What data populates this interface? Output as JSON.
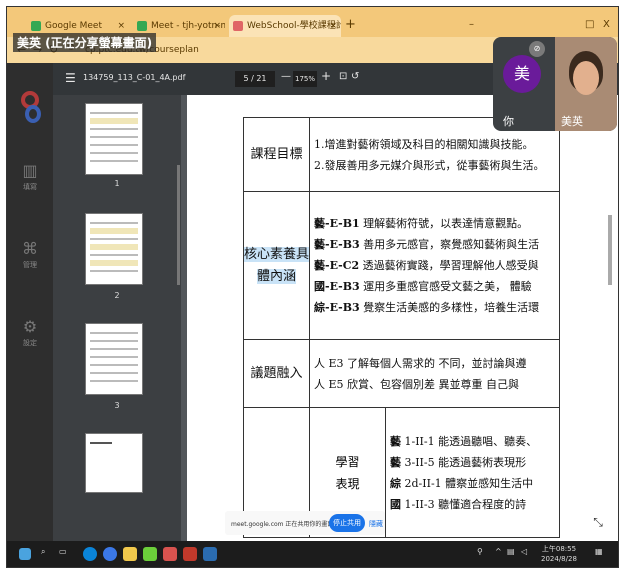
{
  "share_banner": "美英 (正在分享螢幕畫面)",
  "browser": {
    "tabs": [
      {
        "label": "Google Meet",
        "active": false
      },
      {
        "label": "Meet - tjh-yotn-mb",
        "active": false
      },
      {
        "label": "WebSchool-學校課程計畫填報",
        "active": true
      }
    ],
    "new_tab": "+",
    "window_controls": {
      "minimize": "–",
      "maximize": "□",
      "close": "X"
    },
    "url": "cp.ptc.edu.tw/courseplan"
  },
  "left_rail": {
    "items": [
      {
        "label": "填寫",
        "icon": "chart-icon"
      },
      {
        "label": "管理",
        "icon": "grid-icon"
      },
      {
        "label": "設定",
        "icon": "gear-icon"
      }
    ]
  },
  "pdf_toolbar": {
    "title": "134759_113_C-01_4A.pdf",
    "page_indicator": "5 / 21",
    "zoom": "175%",
    "zoom_minus": "—",
    "zoom_plus": "+"
  },
  "thumbnails": {
    "page_numbers": [
      "1",
      "2",
      "3"
    ]
  },
  "document": {
    "rows": [
      {
        "label": "課程目標",
        "lines": [
          "1.增進對藝術領域及科目的相關知識與技能。",
          "2.發展善用多元媒介與形式，從事藝術與生活。"
        ]
      },
      {
        "label": "核心素養具體內涵",
        "lines": [
          {
            "code": "藝-E-B1",
            "text": " 理解藝術符號，以表達情意觀點。"
          },
          {
            "code": "藝-E-B3",
            "text": " 善用多元感官，察覺感知藝術與生活"
          },
          {
            "code": "藝-E-C2",
            "text": " 透過藝術實踐，學習理解他人感受與"
          },
          {
            "code": "國-E-B3",
            "text": " 運用多重感官感受文藝之美， 體驗"
          },
          {
            "code": "綜-E-B3",
            "text": " 覺察生活美感的多樣性，培養生活環"
          }
        ]
      },
      {
        "label": "議題融入",
        "lines": [
          "人 E3 了解每個人需求的 不同，並討論與遵",
          "人 E5 欣賞、包容個別差 異並尊重 自己與"
        ]
      },
      {
        "sub_label_1": "學習",
        "sub_label_2": "表現",
        "lines": [
          {
            "code": "藝",
            "text": " 1-II-1 能透過聽唱、聽奏、"
          },
          {
            "code": "藝",
            "text": " 3-II-5 能透過藝術表現形"
          },
          {
            "code": "綜",
            "text": " 2d-II-1 體察並感知生活中"
          },
          {
            "code": "國",
            "text": " 1-II-3 聽懂適合程度的詩"
          }
        ]
      }
    ]
  },
  "share_notice": {
    "text": "meet.google.com 正在共用你的畫面",
    "stop_label": "停止共用",
    "hide_label": "隱藏"
  },
  "meet": {
    "self_initial": "美",
    "self_label": "你",
    "remote_label": "美英"
  },
  "taskbar": {
    "time": "上午08:55",
    "date": "2024/8/28"
  },
  "colors": {
    "tabbar": "#f3c87a",
    "pdf_toolbar": "#323639",
    "stop_button": "#1a73e8",
    "avatar": "#6a1b9a",
    "highlight": "#c9e3f7"
  }
}
